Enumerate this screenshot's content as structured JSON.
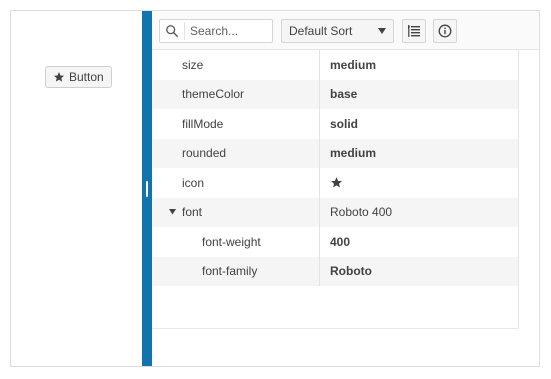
{
  "demo": {
    "button_label": "Button",
    "button_icon": "star-icon"
  },
  "toolbar": {
    "search_placeholder": "Search...",
    "search_value": "",
    "sort_selected": "Default Sort",
    "group_button_icon": "group-list-icon",
    "info_button_icon": "info-icon"
  },
  "properties": [
    {
      "name": "size",
      "value": "medium",
      "bold": true
    },
    {
      "name": "themeColor",
      "value": "base",
      "bold": true
    },
    {
      "name": "fillMode",
      "value": "solid",
      "bold": true
    },
    {
      "name": "rounded",
      "value": "medium",
      "bold": true
    },
    {
      "name": "icon",
      "value": "star-icon",
      "is_icon": true
    },
    {
      "name": "font",
      "value": "Roboto 400",
      "bold": false,
      "expanded": true,
      "children": [
        {
          "name": "font-weight",
          "value": "400",
          "bold": true
        },
        {
          "name": "font-family",
          "value": "Roboto",
          "bold": true
        }
      ]
    }
  ],
  "colors": {
    "splitter": "#1274ac",
    "row_alt": "#f5f5f5",
    "text": "#424242"
  }
}
